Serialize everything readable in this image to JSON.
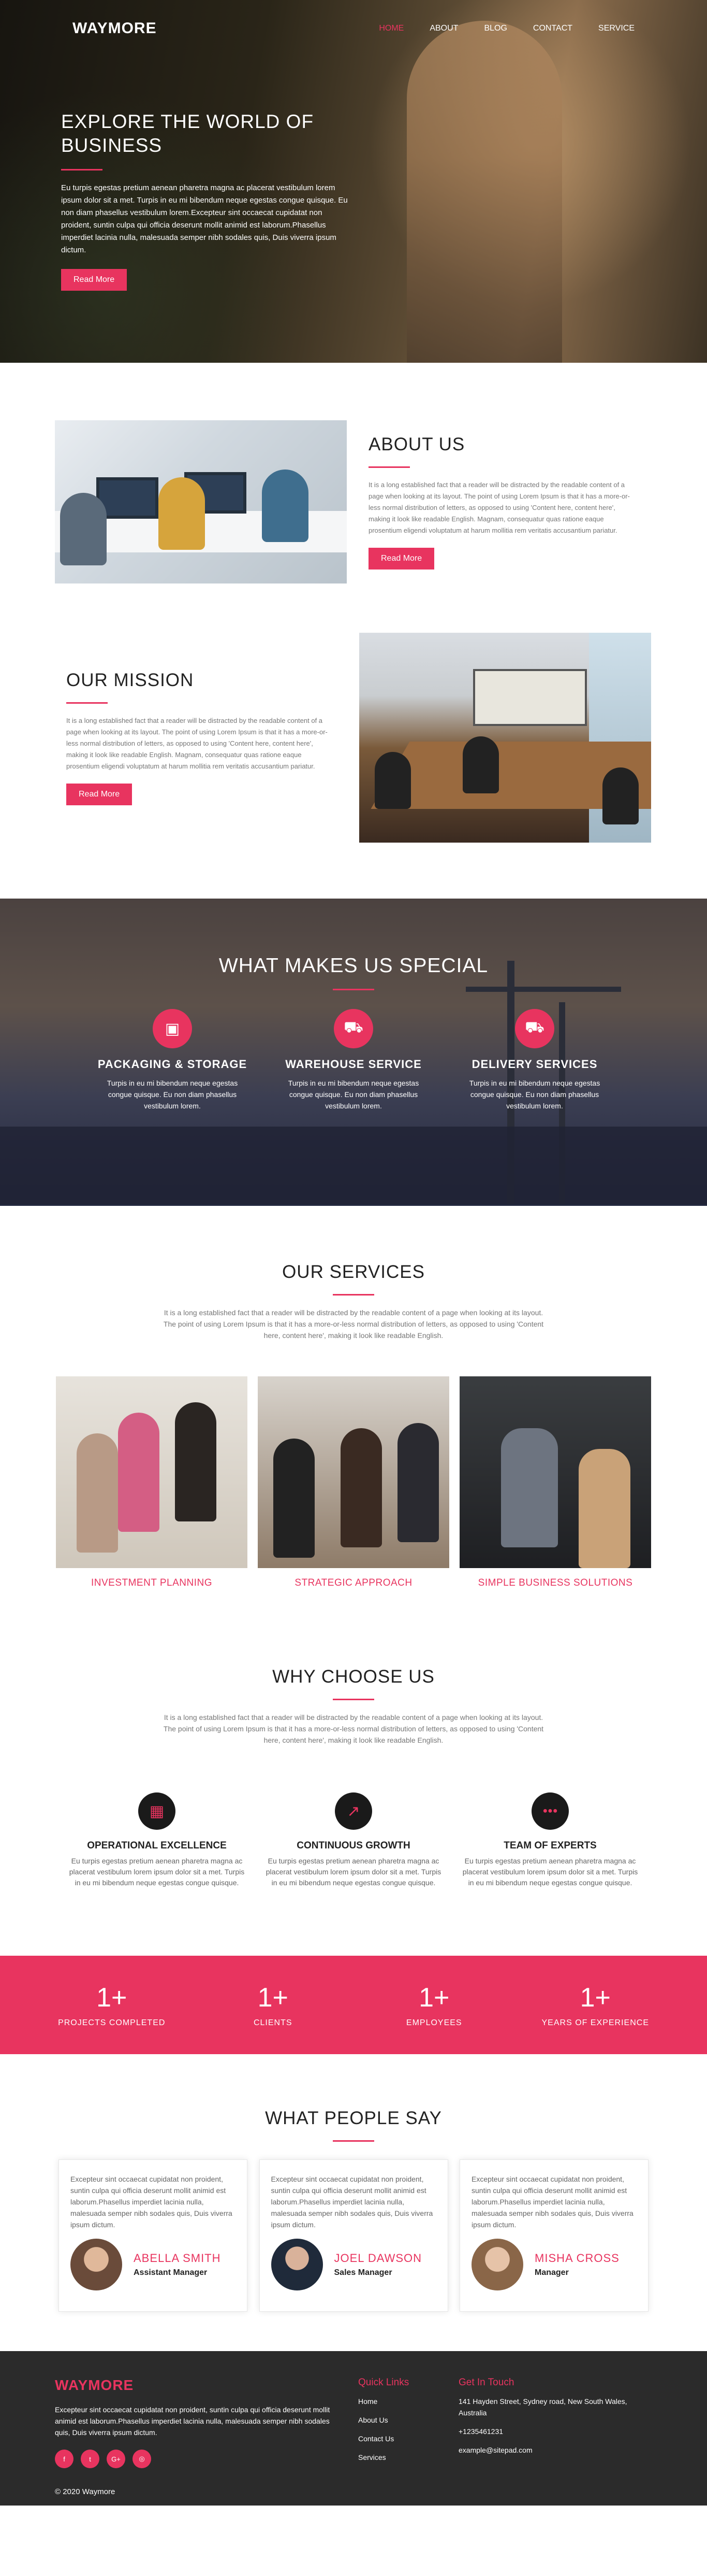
{
  "colors": {
    "accent": "#e8345f",
    "dark": "#2b2b2b"
  },
  "nav": {
    "logo": "WAYMORE",
    "items": [
      {
        "label": "HOME",
        "active": true
      },
      {
        "label": "ABOUT"
      },
      {
        "label": "BLOG"
      },
      {
        "label": "CONTACT"
      },
      {
        "label": "SERVICE"
      }
    ]
  },
  "hero": {
    "title_line1": "EXPLORE THE WORLD OF",
    "title_line2": "BUSINESS",
    "text": "Eu turpis egestas pretium aenean pharetra magna ac placerat vestibulum lorem ipsum dolor sit a met. Turpis in eu mi bibendum neque egestas congue quisque. Eu non diam phasellus vestibulum lorem.Excepteur sint occaecat cupidatat non proident, suntin culpa qui officia deserunt mollit animid est laborum.Phasellus imperdiet lacinia nulla, malesuada semper nibh sodales quis, Duis viverra ipsum dictum.",
    "button": "Read More"
  },
  "about": {
    "title": "ABOUT US",
    "text": "It is a long established fact that a reader will be distracted by the readable content of a page when looking at its layout. The point of using Lorem Ipsum is that it has a more-or-less normal distribution of letters, as opposed to using 'Content here, content here', making it look like readable English. Magnam, consequatur quas ratione eaque prosentium eligendi voluptatum at harum mollitia rem veritatis accusantium pariatur.",
    "button": "Read More"
  },
  "mission": {
    "title": "OUR MISSION",
    "text": "It is a long established fact that a reader will be distracted by the readable content of a page when looking at its layout. The point of using Lorem Ipsum is that it has a more-or-less normal distribution of letters, as opposed to using 'Content here, content here', making it look like readable English. Magnam, consequatur quas ratione eaque prosentium eligendi voluptatum at harum mollitia rem veritatis accusantium pariatur.",
    "button": "Read More"
  },
  "special": {
    "title": "WHAT MAKES US SPECIAL",
    "items": [
      {
        "icon": "box-icon",
        "glyph": "▣",
        "title": "PACKAGING & STORAGE",
        "text": "Turpis in eu mi bibendum neque egestas congue quisque. Eu non diam phasellus vestibulum lorem."
      },
      {
        "icon": "warehouse-icon",
        "glyph": "⛟",
        "title": "WAREHOUSE SERVICE",
        "text": "Turpis in eu mi bibendum neque egestas congue quisque. Eu non diam phasellus vestibulum lorem."
      },
      {
        "icon": "truck-icon",
        "glyph": "⛟",
        "title": "DELIVERY SERVICES",
        "text": "Turpis in eu mi bibendum neque egestas congue quisque. Eu non diam phasellus vestibulum lorem."
      }
    ]
  },
  "services": {
    "title": "OUR SERVICES",
    "lead": "It is a long established fact that a reader will be distracted by the readable content of a page when looking at its layout. The point of using Lorem Ipsum is that it has a more-or-less normal distribution of letters, as opposed to using 'Content here, content here', making it look like readable English.",
    "items": [
      {
        "label": "INVESTMENT PLANNING"
      },
      {
        "label": "STRATEGIC APPROACH"
      },
      {
        "label": "SIMPLE BUSINESS SOLUTIONS"
      }
    ]
  },
  "why": {
    "title": "WHY CHOOSE US",
    "lead": "It is a long established fact that a reader will be distracted by the readable content of a page when looking at its layout. The point of using Lorem Ipsum is that it has a more-or-less normal distribution of letters, as opposed to using 'Content here, content here', making it look like readable English.",
    "items": [
      {
        "icon": "building-icon",
        "glyph": "▦",
        "title": "OPERATIONAL EXCELLENCE",
        "text": "Eu turpis egestas pretium aenean pharetra magna ac placerat vestibulum lorem ipsum dolor sit a met. Turpis in eu mi bibendum neque egestas congue quisque."
      },
      {
        "icon": "growth-chart-icon",
        "glyph": "↗",
        "title": "CONTINUOUS GROWTH",
        "text": "Eu turpis egestas pretium aenean pharetra magna ac placerat vestibulum lorem ipsum dolor sit a met. Turpis in eu mi bibendum neque egestas congue quisque."
      },
      {
        "icon": "team-icon",
        "glyph": "●●●",
        "title": "TEAM OF EXPERTS",
        "text": "Eu turpis egestas pretium aenean pharetra magna ac placerat vestibulum lorem ipsum dolor sit a met. Turpis in eu mi bibendum neque egestas congue quisque."
      }
    ]
  },
  "stats": [
    {
      "num": "1+",
      "label": "PROJECTS COMPLETED"
    },
    {
      "num": "1+",
      "label": "CLIENTS"
    },
    {
      "num": "1+",
      "label": "EMPLOYEES"
    },
    {
      "num": "1+",
      "label": "YEARS OF EXPERIENCE"
    }
  ],
  "testimonials": {
    "title": "WHAT PEOPLE SAY",
    "items": [
      {
        "text": "Excepteur sint occaecat cupidatat non proident, suntin culpa qui officia deserunt mollit animid est laborum.Phasellus imperdiet lacinia nulla, malesuada semper nibh sodales quis, Duis viverra ipsum dictum.",
        "name": "ABELLA SMITH",
        "role": "Assistant Manager"
      },
      {
        "text": "Excepteur sint occaecat cupidatat non proident, suntin culpa qui officia deserunt mollit animid est laborum.Phasellus imperdiet lacinia nulla, malesuada semper nibh sodales quis, Duis viverra ipsum dictum.",
        "name": "JOEL DAWSON",
        "role": "Sales Manager"
      },
      {
        "text": "Excepteur sint occaecat cupidatat non proident, suntin culpa qui officia deserunt mollit animid est laborum.Phasellus imperdiet lacinia nulla, malesuada semper nibh sodales quis, Duis viverra ipsum dictum.",
        "name": "MISHA CROSS",
        "role": "Manager"
      }
    ]
  },
  "footer": {
    "logo": "WAYMORE",
    "text": "Excepteur sint occaecat cupidatat non proident, suntin culpa qui officia deserunt mollit animid est laborum.Phasellus imperdiet lacinia nulla, malesuada semper nibh sodales quis, Duis viverra ipsum dictum.",
    "social": [
      "f",
      "t",
      "G+",
      "◎"
    ],
    "links_title": "Quick Links",
    "links": [
      "Home",
      "About Us",
      "Contact Us",
      "Services"
    ],
    "contact_title": "Get In Touch",
    "address": "141 Hayden Street, Sydney road, New South Wales, Australia",
    "phone": "+1235461231",
    "email": "example@sitepad.com",
    "copyright": "© 2020 Waymore"
  }
}
